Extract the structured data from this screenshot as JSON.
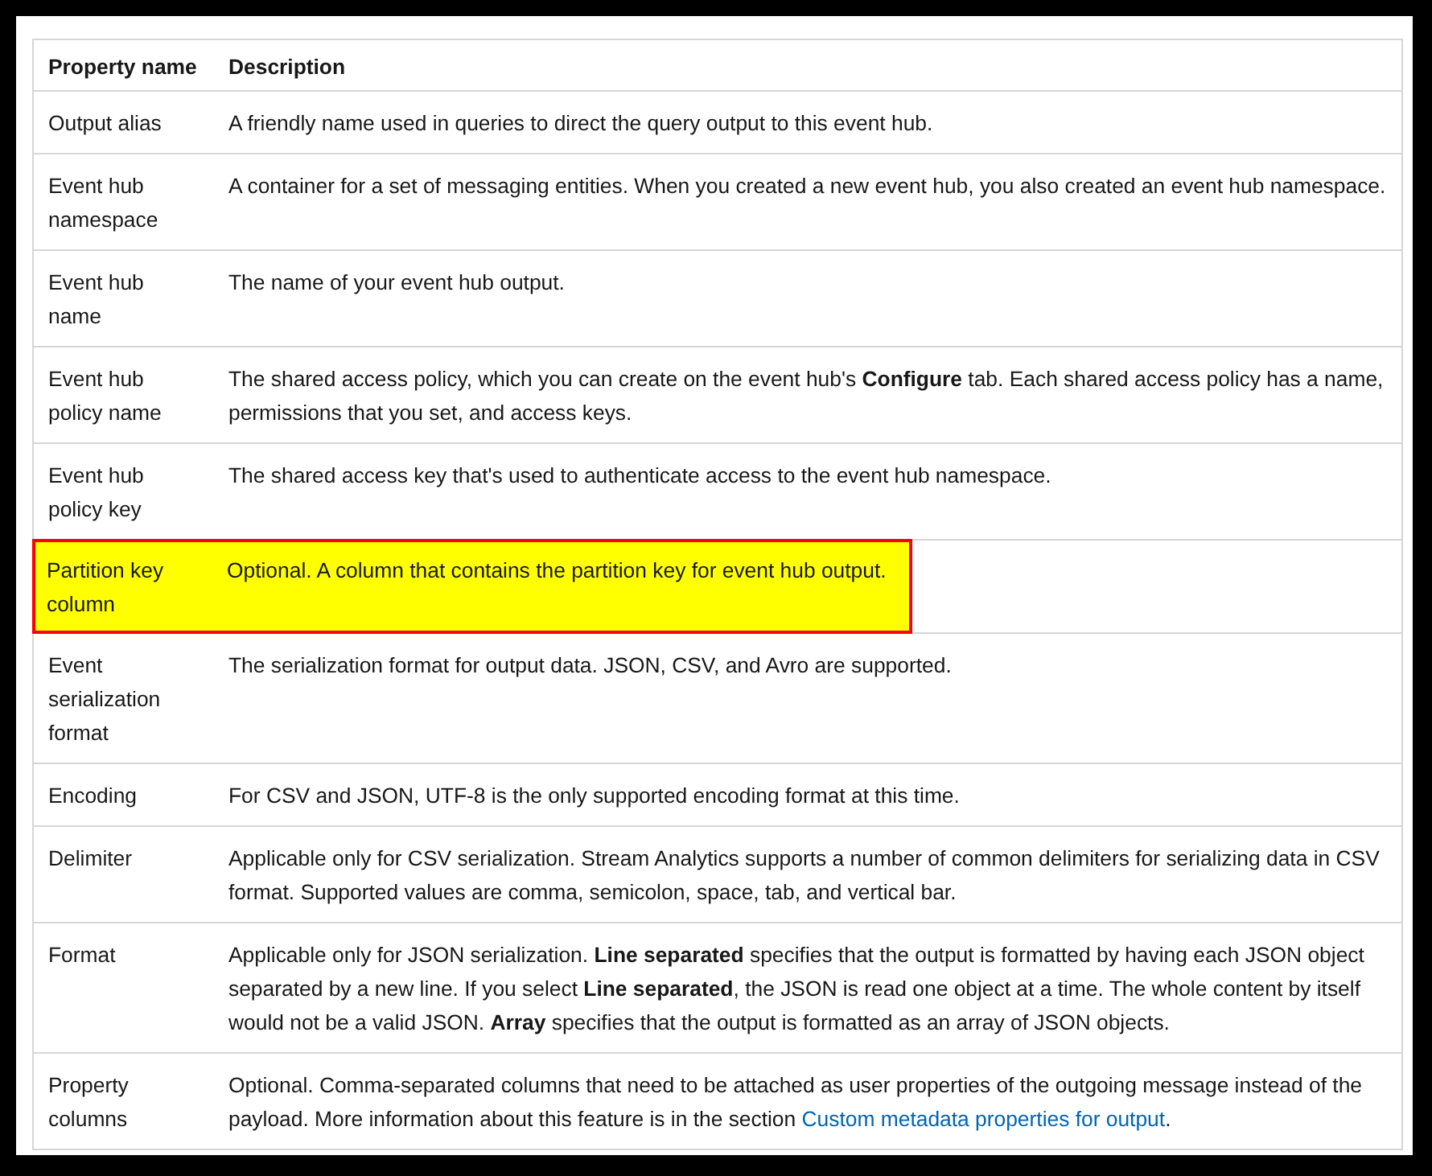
{
  "table": {
    "columns": [
      "Property name",
      "Description"
    ],
    "rows": [
      {
        "name": "Output alias",
        "description": "A friendly name used in queries to direct the query output to this event hub.",
        "highlighted": false
      },
      {
        "name": "Event hub namespace",
        "description": "A container for a set of messaging entities. When you created a new event hub, you also created an event hub namespace.",
        "highlighted": false
      },
      {
        "name": "Event hub name",
        "description": "The name of your event hub output.",
        "highlighted": false
      },
      {
        "name": "Event hub policy name",
        "description": "The shared access policy, which you can create on the event hub's **Configure** tab. Each shared access policy has a name, permissions that you set, and access keys.",
        "highlighted": false
      },
      {
        "name": "Event hub policy key",
        "description": "The shared access key that's used to authenticate access to the event hub namespace.",
        "highlighted": false
      },
      {
        "name": "Partition key column",
        "description": "Optional. A column that contains the partition key for event hub output.",
        "highlighted": true
      },
      {
        "name": "Event serialization format",
        "description": "The serialization format for output data. JSON, CSV, and Avro are supported.",
        "highlighted": false
      },
      {
        "name": "Encoding",
        "description": "For CSV and JSON, UTF-8 is the only supported encoding format at this time.",
        "highlighted": false
      },
      {
        "name": "Delimiter",
        "description": "Applicable only for CSV serialization. Stream Analytics supports a number of common delimiters for serializing data in CSV format. Supported values are comma, semicolon, space, tab, and vertical bar.",
        "highlighted": false
      },
      {
        "name": "Format",
        "description": "Applicable only for JSON serialization. **Line separated** specifies that the output is formatted by having each JSON object separated by a new line. If you select **Line separated**, the JSON is read one object at a time. The whole content by itself would not be a valid JSON. **Array** specifies that the output is formatted as an array of JSON objects.",
        "highlighted": false
      },
      {
        "name": "Property columns",
        "description": "Optional. Comma-separated columns that need to be attached as user properties of the outgoing message instead of the payload. More information about this feature is in the section",
        "link": "Custom metadata properties for output",
        "after_link": ".",
        "highlighted": false
      }
    ]
  }
}
